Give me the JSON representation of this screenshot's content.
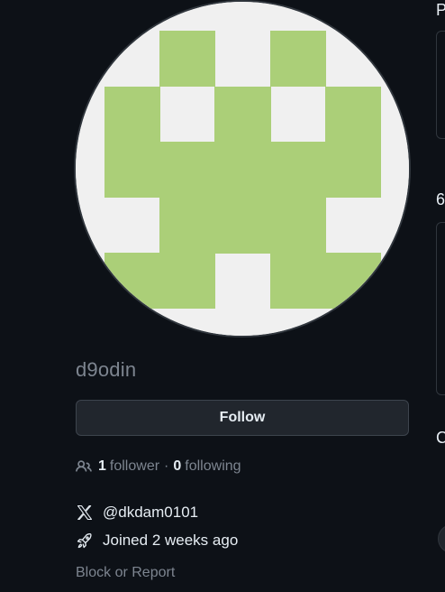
{
  "profile": {
    "username": "d9odin",
    "follow_label": "Follow",
    "followers_count": "1",
    "followers_label": "follower",
    "separator": "·",
    "following_count": "0",
    "following_label": "following",
    "x_handle": "@dkdam0101",
    "joined_text": "Joined 2 weeks ago",
    "block_report_label": "Block or Report",
    "avatar": {
      "foreground_color": "#abcf78",
      "background_color": "#f0f0f0"
    }
  },
  "right_column": {
    "heading_1": "P",
    "heading_2": "6",
    "heading_3": "C"
  },
  "icons": {
    "people": "people-icon",
    "x_logo": "x-logo-icon",
    "rocket": "rocket-icon"
  },
  "colors": {
    "background": "#0d1117",
    "muted_text": "#7d8590",
    "text": "#e6edf3",
    "button_bg": "#21262d",
    "border": "#30363d"
  }
}
